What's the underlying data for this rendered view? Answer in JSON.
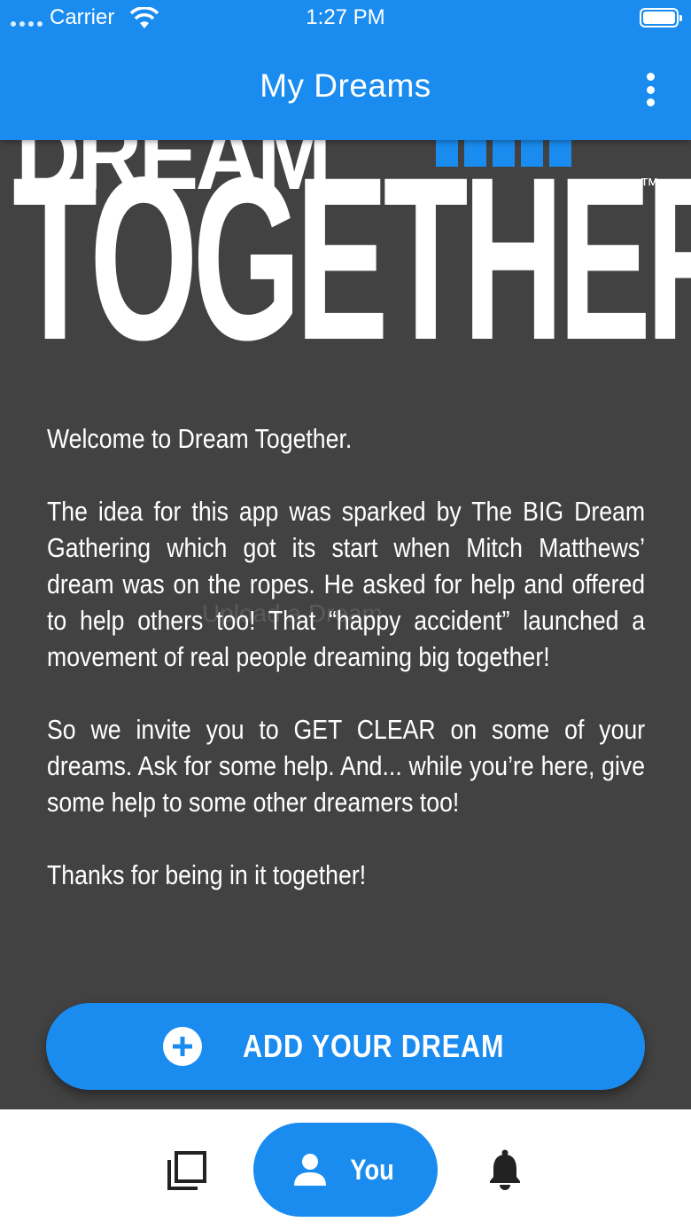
{
  "status_bar": {
    "carrier": "Carrier",
    "time": "1:27 PM"
  },
  "app_bar": {
    "title": "My Dreams",
    "menu_icon": "more-vertical-icon"
  },
  "logo": {
    "top_word": "DREAM",
    "main_word": "TOGETHER",
    "trademark": "™",
    "accent_color": "#1a8cf0"
  },
  "content": {
    "paragraphs": [
      "Welcome to Dream Together.",
      "The idea for this app was sparked by The BIG Dream Gathering which got its start when Mitch Matthews’ dream was on the ropes. He asked for help and offered to help others too! That “happy accident” launched a movement of real people dreaming big together!",
      "So we invite you to GET CLEAR on some of your dreams.  Ask for some help.  And... while you’re here, give some help to some other dreamers too!",
      "Thanks for being in it together!"
    ],
    "watermark": "Upload a Dream"
  },
  "cta": {
    "label": "ADD YOUR DREAM",
    "icon": "plus-circle-icon"
  },
  "bottom_nav": {
    "items": [
      {
        "icon": "copy-stack-icon",
        "label": ""
      },
      {
        "icon": "person-icon",
        "label": "You",
        "active": true
      },
      {
        "icon": "bell-icon",
        "label": ""
      }
    ]
  },
  "colors": {
    "primary": "#1a8cf0",
    "background": "#424242",
    "nav_background": "#ffffff"
  }
}
